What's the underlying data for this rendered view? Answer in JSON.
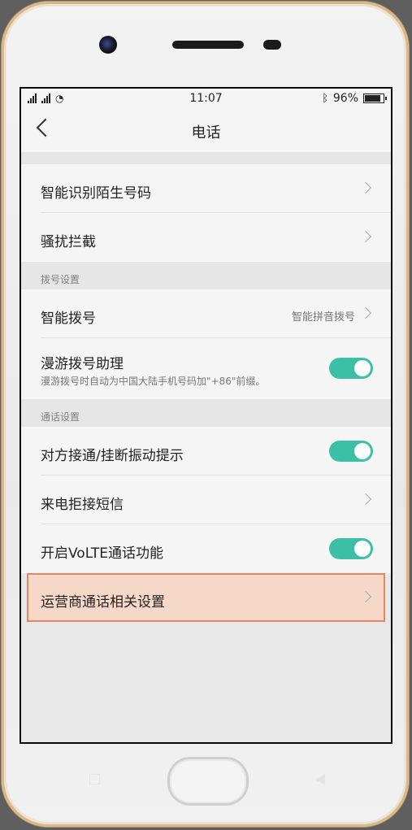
{
  "status": {
    "time": "11:07",
    "battery": "96%"
  },
  "header": {
    "title": "电话"
  },
  "groups": [
    {
      "items": [
        {
          "label": "智能识别陌生号码"
        },
        {
          "label": "骚扰拦截"
        }
      ]
    },
    {
      "header": "拨号设置",
      "items": [
        {
          "label": "智能拨号",
          "value": "智能拼音拨号"
        },
        {
          "label": "漫游拨号助理",
          "sub": "漫游拨号时自动为中国大陆手机号码加\"+86\"前缀。",
          "toggle": true
        }
      ]
    },
    {
      "header": "通话设置",
      "items": [
        {
          "label": "对方接通/挂断振动提示",
          "toggle": true
        },
        {
          "label": "来电拒接短信"
        },
        {
          "label": "开启VoLTE通话功能",
          "toggle": true
        },
        {
          "label": "运营商通话相关设置"
        }
      ]
    }
  ],
  "colors": {
    "accent": "#3cbfa4",
    "highlight_bg": "#f6d8c8",
    "highlight_border": "#e8845f"
  }
}
